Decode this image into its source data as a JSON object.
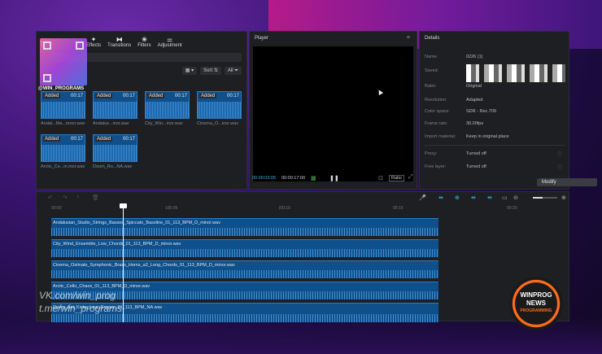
{
  "media_panel": {
    "tools": [
      {
        "icon": "text-icon",
        "label": ""
      },
      {
        "icon": "effects-icon",
        "label": "Effects"
      },
      {
        "icon": "transitions-icon",
        "label": "Transitions"
      },
      {
        "icon": "filters-icon",
        "label": "Filters"
      },
      {
        "icon": "adjustment-icon",
        "label": "Adjustment"
      }
    ],
    "sort_label": "Sort",
    "all_label": "All",
    "qr_caption": "@WIN_PROGRAMS",
    "clips": [
      {
        "tag": "Added",
        "dur": "00:17",
        "name": "Andal...Ma...mnor.wav"
      },
      {
        "tag": "Added",
        "dur": "00:17",
        "name": "Andalus...inor.wav"
      },
      {
        "tag": "Added",
        "dur": "00:17",
        "name": "City_Win...inor.wav"
      },
      {
        "tag": "Added",
        "dur": "00:17",
        "name": "Cinema_O...inor.wav"
      },
      {
        "tag": "Added",
        "dur": "00:17",
        "name": "Arctic_Ce...in.inor.wav"
      },
      {
        "tag": "Added",
        "dur": "00:17",
        "name": "Doom_Ro...NA.wav"
      }
    ]
  },
  "player": {
    "title": "Player",
    "time_current": "00:00:03:05",
    "time_total": "00:00:17:00",
    "ratio_label": "Ratio"
  },
  "details": {
    "title": "Details",
    "rows": [
      {
        "label": "Name:",
        "value": "0226 (1)"
      },
      {
        "label": "Saved:",
        "value": ""
      },
      {
        "label": "Ratio:",
        "value": "Original"
      },
      {
        "label": "Resolution:",
        "value": "Adapted"
      },
      {
        "label": "Color space:",
        "value": "SDR - Rec.709"
      },
      {
        "label": "Frame rate:",
        "value": "30.00fps"
      },
      {
        "label": "Import material:",
        "value": "Keep in original place"
      },
      {
        "label": "Proxy:",
        "value": "Turned off"
      },
      {
        "label": "Free layer:",
        "value": "Turned off"
      }
    ],
    "modify_label": "Modify"
  },
  "timeline": {
    "ruler": [
      "00:00",
      "100:05",
      "|00:10",
      "00:15",
      "00:20"
    ],
    "tracks": [
      "Andalusian_Studio_Strings_Basses_Spiccato_Bassline_01_113_BPM_D_minor.wav",
      "City_Wind_Ensemble_Low_Chords_01_113_BPM_D_minor.wav",
      "Cinema_Ostinato_Symphonic_Brass_Horns_a2_Long_Chords_01_113_BPM_D_minor.wav",
      "Arctic_Cello_Chaos_01_113_BPM_D_minor.wav",
      "Doom_Ant_Kicks_Low_Groove_01_113_BPM_NA.wav"
    ]
  },
  "overlay": {
    "watermark_line1": "VK.com/win_prog",
    "watermark_line2": "t.me/win_programs",
    "badge_top": "WINPROG",
    "badge_mid": "NEWS",
    "badge_bottom": "PROGRAMMING"
  }
}
